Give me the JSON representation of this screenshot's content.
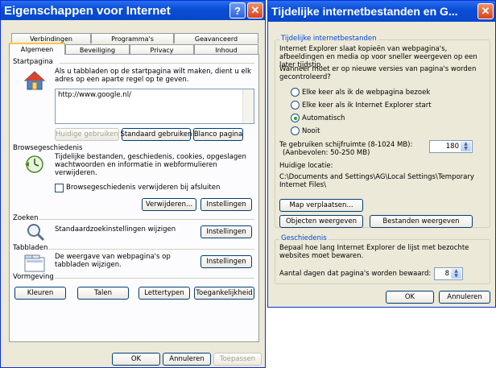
{
  "left": {
    "title": "Eigenschappen voor Internet",
    "help_label": "?",
    "close_label": "✕",
    "tabs_row1": [
      "Verbindingen",
      "Programma's",
      "Geavanceerd"
    ],
    "tabs_row2": [
      "Algemeen",
      "Beveiliging",
      "Privacy",
      "Inhoud"
    ],
    "startpagina": {
      "label": "Startpagina",
      "desc": "Als u tabbladen op de startpagina wilt maken, dient u elk adres op een aparte regel op te geven.",
      "url": "http://www.google.nl/",
      "btn_current": "Huidige gebruiken",
      "btn_default": "Standaard gebruiken",
      "btn_blank": "Blanco pagina"
    },
    "browse": {
      "label": "Browsegeschiedenis",
      "desc": "Tijdelijke bestanden, geschiedenis, cookies, opgeslagen wachtwoorden en informatie in webformulieren verwijderen.",
      "checkbox": "Browsegeschiedenis verwijderen bij afsluiten",
      "btn_delete": "Verwijderen...",
      "btn_settings": "Instellingen"
    },
    "zoeken": {
      "label": "Zoeken",
      "desc": "Standaardzoekinstellingen wijzigen",
      "btn_settings": "Instellingen"
    },
    "tabbladen": {
      "label": "Tabbladen",
      "desc": "De weergave van webpagina's op tabbladen wijzigen.",
      "btn_settings": "Instellingen"
    },
    "vormgeving": {
      "label": "Vormgeving",
      "btn_colors": "Kleuren",
      "btn_languages": "Talen",
      "btn_fonts": "Lettertypen",
      "btn_access": "Toegankelijkheid"
    },
    "footer": {
      "ok": "OK",
      "cancel": "Annuleren",
      "apply": "Toepassen"
    }
  },
  "right": {
    "title": "Tijdelijke internetbestanden en G...",
    "close_label": "✕",
    "temp": {
      "legend": "Tijdelijke internetbestanden",
      "desc": "Internet Explorer slaat kopieën van webpagina's, afbeeldingen en media op voor sneller weergeven op een later tijdstip.",
      "question": "Wanneer moet er op nieuwe versies van pagina's worden gecontroleerd?",
      "radios": [
        {
          "label": "Elke keer als ik de webpagina bezoek",
          "checked": false
        },
        {
          "label": "Elke keer als ik Internet Explorer start",
          "checked": false
        },
        {
          "label": "Automatisch",
          "checked": true
        },
        {
          "label": "Nooit",
          "checked": false
        }
      ],
      "disk_label": "Te gebruiken schijfruimte (8-1024 MB):",
      "disk_recommended": "(Aanbevolen: 50-250 MB)",
      "disk_value": "180",
      "location_label": "Huidige locatie:",
      "location_path": "C:\\Documents and Settings\\AG\\Local Settings\\Temporary Internet Files\\",
      "btn_move": "Map verplaatsen...",
      "btn_objects": "Objecten weergeven",
      "btn_files": "Bestanden weergeven"
    },
    "history": {
      "legend": "Geschiedenis",
      "desc": "Bepaal hoe lang Internet Explorer de lijst met bezochte websites moet bewaren.",
      "days_label": "Aantal dagen dat pagina's worden bewaard:",
      "days_value": "8"
    },
    "footer": {
      "ok": "OK",
      "cancel": "Annuleren"
    }
  }
}
